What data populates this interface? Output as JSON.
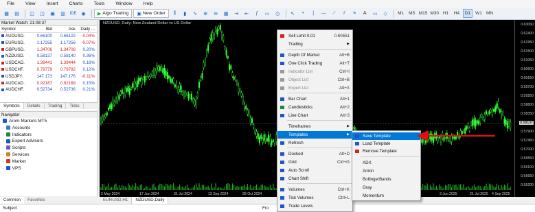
{
  "menubar": [
    "File",
    "View",
    "Insert",
    "Charts",
    "Tools",
    "Window",
    "Help"
  ],
  "toolbar": {
    "algo_trading": "Algo Trading",
    "new_order": "New Order",
    "ide_label": "IDE",
    "timeframes": [
      "M1",
      "M5",
      "M15",
      "M30",
      "H1",
      "H4",
      "D1",
      "W1",
      "MN"
    ],
    "active_timeframe": "D1"
  },
  "market_watch": {
    "title": "Market Watch: 21:08:37",
    "columns": [
      "Symbol",
      "Bid",
      "Ask",
      "Daily ..."
    ],
    "rows": [
      {
        "symbol": "AUDUSD.",
        "bid": "0.66100",
        "ask": "0.66102",
        "change": "-0.04%",
        "dir": "dn"
      },
      {
        "symbol": "EURUSD.",
        "bid": "1.17255",
        "ask": "1.17256",
        "change": "-0.07%",
        "dir": "dn"
      },
      {
        "symbol": "GBPUSD.",
        "bid": "1.34706",
        "ask": "1.34708",
        "change": "0.20%",
        "dir": "up"
      },
      {
        "symbol": "NZDUSD.",
        "bid": "0.58137",
        "ask": "0.58140",
        "change": "0.36%",
        "dir": "dn"
      },
      {
        "symbol": "USDCAD.",
        "bid": "1.39441",
        "ask": "1.39444",
        "change": "0.18%",
        "dir": "up"
      },
      {
        "symbol": "USDCHF.",
        "bid": "0.79779",
        "ask": "0.79782",
        "change": "0.12%",
        "dir": "up"
      },
      {
        "symbol": "USDJPY.",
        "bid": "147.173",
        "ask": "147.176",
        "change": "-0.11%",
        "dir": "dn"
      },
      {
        "symbol": "AUDCAD.",
        "bid": "0.92167",
        "ask": "0.92169",
        "change": "0.15%",
        "dir": "up"
      },
      {
        "symbol": "AUDCHF.",
        "bid": "0.52734",
        "ask": "0.52736",
        "change": "0.21%",
        "dir": "dn"
      }
    ],
    "tabs": [
      "Symbols",
      "Details",
      "Trading",
      "Ticks"
    ]
  },
  "navigator": {
    "title": "Navigator",
    "items": [
      "Arom Markets MT5",
      "Accounts",
      "Indicators",
      "Expert Advisors",
      "Scripts",
      "Services",
      "Market",
      "VPS"
    ],
    "tabs": [
      "Common",
      "Favorites"
    ]
  },
  "chart": {
    "title": "NZDUSD, Daily: New Zealand Dollar vs US Dollar",
    "y_ticks": [
      "0.63060",
      "0.62400",
      "0.61950",
      "0.61500",
      "0.61050",
      "0.60600",
      "0.60150",
      "0.59700",
      "0.59250",
      "0.58800",
      "0.58350",
      "0.58137",
      "0.57900",
      "0.57450",
      "0.57000",
      "0.56550",
      "0.56100",
      "0.55650",
      "0.55200"
    ],
    "current_price": "0.58137",
    "x_ticks": [
      "2 May 2024",
      "17 Jun 2024",
      "31 Jul 2024",
      "13 Sep 2024",
      "28 Oct 2024",
      "11 Dec 2024",
      "3 Jun 2025",
      "21 Jul 2025",
      "4 Sep 2025"
    ],
    "tabs": [
      "EURUSD,H1",
      "NZDUSD,Daily"
    ],
    "active_tab": "NZDUSD,Daily"
  },
  "context_menu": {
    "items": [
      {
        "label": "Sell Limit 0.01",
        "shortcut": "0.60651",
        "state": "normal",
        "icon": "sell-limit-icon"
      },
      {
        "label": "Trading",
        "shortcut": "",
        "state": "submenu",
        "icon": ""
      },
      {
        "label": "Depth Of Market",
        "shortcut": "Alt+B",
        "state": "normal",
        "icon": "depth-of-market-icon"
      },
      {
        "label": "One Click Trading",
        "shortcut": "Alt+T",
        "state": "normal",
        "icon": "one-click-trading-icon"
      },
      {
        "label": "Indicator List",
        "shortcut": "Ctrl+I",
        "state": "disabled",
        "icon": "indicator-list-icon"
      },
      {
        "label": "Object List",
        "shortcut": "Ctrl+B",
        "state": "disabled",
        "icon": "object-list-icon"
      },
      {
        "label": "Expert List",
        "shortcut": "Alt+X",
        "state": "disabled",
        "icon": "expert-list-icon"
      },
      {
        "label": "Bar Chart",
        "shortcut": "Alt+1",
        "state": "normal",
        "icon": "bar-chart-icon"
      },
      {
        "label": "Candlesticks",
        "shortcut": "Alt+2",
        "state": "normal",
        "icon": "candlesticks-icon"
      },
      {
        "label": "Line Chart",
        "shortcut": "Alt+3",
        "state": "normal",
        "icon": "line-chart-icon"
      },
      {
        "label": "Timeframes",
        "shortcut": "",
        "state": "submenu",
        "icon": ""
      },
      {
        "label": "Templates",
        "shortcut": "",
        "state": "selected",
        "icon": ""
      },
      {
        "label": "Refresh",
        "shortcut": "",
        "state": "normal",
        "icon": "refresh-icon"
      },
      {
        "label": "Docked",
        "shortcut": "Alt+D",
        "state": "normal",
        "icon": "docked-icon"
      },
      {
        "label": "Grid",
        "shortcut": "Ctrl+G",
        "state": "normal",
        "icon": "grid-icon"
      },
      {
        "label": "Auto Scroll",
        "shortcut": "",
        "state": "normal",
        "icon": "auto-scroll-icon"
      },
      {
        "label": "Chart Shift",
        "shortcut": "",
        "state": "normal",
        "icon": "chart-shift-icon"
      },
      {
        "label": "Volumes",
        "shortcut": "Ctrl+K",
        "state": "normal",
        "icon": "volumes-icon"
      },
      {
        "label": "Tick Volumes",
        "shortcut": "Ctrl+L",
        "state": "normal",
        "icon": "tick-volumes-icon"
      },
      {
        "label": "Trade Levels",
        "shortcut": "",
        "state": "normal",
        "icon": "trade-levels-icon"
      }
    ]
  },
  "templates_submenu": {
    "items": [
      "Save Template",
      "Load Template",
      "Remove Template",
      "ADX",
      "Armin",
      "BollingerBands",
      "Gray",
      "Momentum"
    ],
    "selected": "Save Template"
  },
  "bottom_bar": {
    "subject": "Subject",
    "from": "Fro"
  },
  "colors": {
    "candle": "#33ff33",
    "chart_bg": "#000000",
    "menu_highlight": "#0078d7",
    "arrow": "#e01010"
  }
}
